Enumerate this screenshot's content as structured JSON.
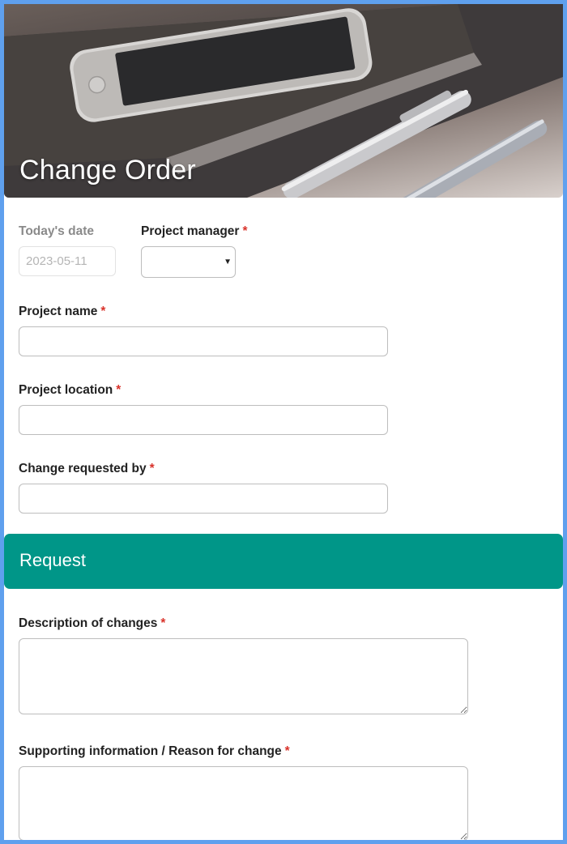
{
  "header": {
    "title": "Change Order"
  },
  "form": {
    "todays_date": {
      "label": "Today's date",
      "value": "2023-05-11"
    },
    "project_manager": {
      "label": "Project manager",
      "required_marker": "*",
      "selected_value": ""
    },
    "project_name": {
      "label": "Project name",
      "required_marker": "*",
      "value": ""
    },
    "project_location": {
      "label": "Project location",
      "required_marker": "*",
      "value": ""
    },
    "change_requested_by": {
      "label": "Change requested by",
      "required_marker": "*",
      "value": ""
    }
  },
  "request_section": {
    "title": "Request",
    "description": {
      "label": "Description of changes",
      "required_marker": "*",
      "value": ""
    },
    "supporting_info": {
      "label": "Supporting information / Reason for change",
      "required_marker": "*",
      "value": ""
    }
  },
  "theme": {
    "border_color": "#5fa0ee",
    "section_color": "#009688",
    "required_color": "#d9332b"
  }
}
